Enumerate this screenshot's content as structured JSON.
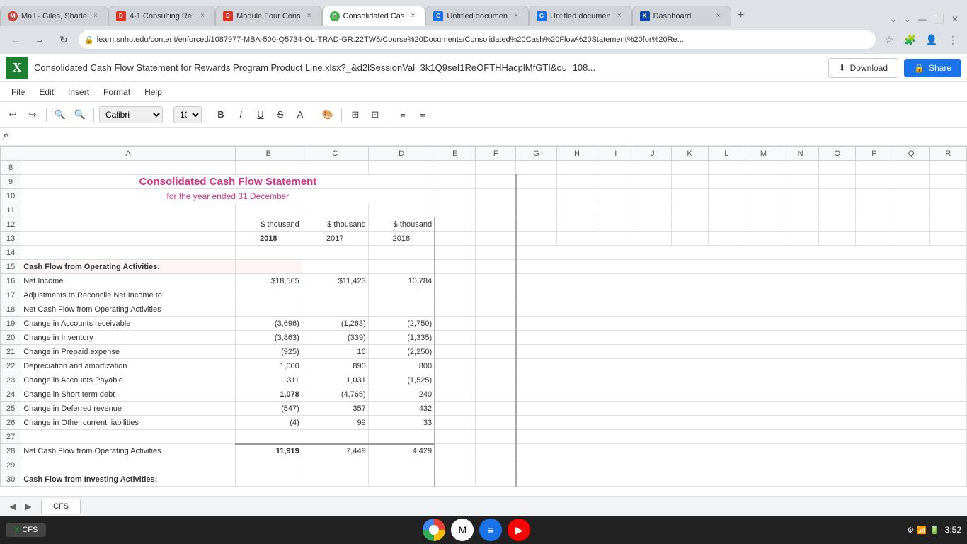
{
  "browser": {
    "tabs": [
      {
        "id": "tab1",
        "label": "Mail - Giles, Shade",
        "favicon": "M",
        "active": false,
        "favicon_color": "#1a73e8"
      },
      {
        "id": "tab2",
        "label": "4-1 Consulting Re:",
        "favicon": "D",
        "active": false,
        "favicon_color": "#d32f2f"
      },
      {
        "id": "tab3",
        "label": "Module Four Cons",
        "favicon": "D",
        "active": false,
        "favicon_color": "#d32f2f"
      },
      {
        "id": "tab4",
        "label": "Consolidated Cas",
        "favicon": "C",
        "active": true,
        "favicon_color": "#4caf50"
      },
      {
        "id": "tab5",
        "label": "Untitled documen",
        "favicon": "G",
        "active": false,
        "favicon_color": "#1a73e8"
      },
      {
        "id": "tab6",
        "label": "Untitled documen",
        "favicon": "G",
        "active": false,
        "favicon_color": "#1a73e8"
      },
      {
        "id": "tab7",
        "label": "Dashboard",
        "favicon": "K",
        "active": false,
        "favicon_color": "#0d47a1"
      }
    ],
    "address": "learn.snhu.edu/content/enforced/1087977-MBA-500-Q5734-OL-TRAD-GR.22TW5/Course%20Documents/Consolidated%20Cash%20Flow%20Statement%20for%20Re..."
  },
  "app": {
    "logo": "X",
    "title": "Consolidated Cash Flow Statement for Rewards Program Product Line.xlsx?_&d2lSessionVal=3k1Q9seI1ReOFTHHacplMfGTI&ou=108...",
    "download_label": "Download",
    "share_label": "Share"
  },
  "menu": {
    "items": [
      "File",
      "Edit",
      "Insert",
      "Format",
      "Help"
    ]
  },
  "toolbar": {
    "font": "Calibri",
    "size": "10"
  },
  "spreadsheet": {
    "columns": [
      "",
      "A",
      "B",
      "C",
      "D",
      "E",
      "F",
      "G",
      "H",
      "I",
      "J",
      "K",
      "L",
      "M",
      "N",
      "O",
      "P",
      "Q",
      "R"
    ],
    "title": "Consolidated Cash Flow Statement",
    "subtitle": "for the year ended 31 December",
    "rows": [
      {
        "num": 8,
        "cells": []
      },
      {
        "num": 9,
        "cells": [
          {
            "col": "merged_abc",
            "text": "Consolidated Cash Flow Statement",
            "class": "title-cell"
          }
        ]
      },
      {
        "num": 10,
        "cells": [
          {
            "col": "merged_abc",
            "text": "for the year ended 31 December",
            "class": "subtitle-cell"
          }
        ]
      },
      {
        "num": 11,
        "cells": []
      },
      {
        "num": 12,
        "cells": [
          {
            "col": "B",
            "text": "$ thousand",
            "class": "header-label"
          },
          {
            "col": "C",
            "text": "$ thousand",
            "class": "header-label"
          },
          {
            "col": "D",
            "text": "$ thousand",
            "class": "header-label"
          }
        ]
      },
      {
        "num": 13,
        "cells": [
          {
            "col": "B",
            "text": "2018",
            "class": "year-label"
          },
          {
            "col": "C",
            "text": "2017",
            "class": "year-label"
          },
          {
            "col": "D",
            "text": "2016",
            "class": "year-label"
          }
        ]
      },
      {
        "num": 14,
        "cells": []
      },
      {
        "num": 15,
        "cells": [
          {
            "col": "A",
            "text": "Cash Flow from Operating Activities:",
            "class": "section-label"
          }
        ]
      },
      {
        "num": 16,
        "cells": [
          {
            "col": "A",
            "text": "Net Income",
            "class": "item-label"
          },
          {
            "col": "B",
            "text": "$18,565",
            "class": "value-cell"
          },
          {
            "col": "C",
            "text": "$11,423",
            "class": "value-cell"
          },
          {
            "col": "D",
            "text": "10,784",
            "class": "value-cell"
          }
        ]
      },
      {
        "num": 17,
        "cells": [
          {
            "col": "A",
            "text": "Adjustments to Reconcile Net Income to",
            "class": "item-label"
          }
        ]
      },
      {
        "num": 18,
        "cells": [
          {
            "col": "A",
            "text": "Net Cash Flow from Operating Activities",
            "class": "item-label"
          }
        ]
      },
      {
        "num": 19,
        "cells": [
          {
            "col": "A",
            "text": "Change in Accounts receivable",
            "class": "item-label"
          },
          {
            "col": "B",
            "text": "(3,696)",
            "class": "value-cell"
          },
          {
            "col": "C",
            "text": "(1,263)",
            "class": "value-cell"
          },
          {
            "col": "D",
            "text": "(2,750)",
            "class": "value-cell"
          }
        ]
      },
      {
        "num": 20,
        "cells": [
          {
            "col": "A",
            "text": "Change in Inventory",
            "class": "item-label"
          },
          {
            "col": "B",
            "text": "(3,863)",
            "class": "value-cell"
          },
          {
            "col": "C",
            "text": "(339)",
            "class": "value-cell"
          },
          {
            "col": "D",
            "text": "(1,335)",
            "class": "value-cell"
          }
        ]
      },
      {
        "num": 21,
        "cells": [
          {
            "col": "A",
            "text": "Change in Prepaid expense",
            "class": "item-label"
          },
          {
            "col": "B",
            "text": "(925)",
            "class": "value-cell"
          },
          {
            "col": "C",
            "text": "16",
            "class": "value-cell"
          },
          {
            "col": "D",
            "text": "(2,250)",
            "class": "value-cell"
          }
        ]
      },
      {
        "num": 22,
        "cells": [
          {
            "col": "A",
            "text": "Depreciation and amortization",
            "class": "item-label"
          },
          {
            "col": "B",
            "text": "1,000",
            "class": "value-cell"
          },
          {
            "col": "C",
            "text": "890",
            "class": "value-cell"
          },
          {
            "col": "D",
            "text": "800",
            "class": "value-cell"
          }
        ]
      },
      {
        "num": 23,
        "cells": [
          {
            "col": "A",
            "text": "Change in Accounts Payable",
            "class": "item-label"
          },
          {
            "col": "B",
            "text": "311",
            "class": "value-cell"
          },
          {
            "col": "C",
            "text": "1,031",
            "class": "value-cell"
          },
          {
            "col": "D",
            "text": "(1,525)",
            "class": "value-cell"
          }
        ]
      },
      {
        "num": 24,
        "cells": [
          {
            "col": "A",
            "text": "Change in Short term debt",
            "class": "item-label"
          },
          {
            "col": "B",
            "text": "1,078",
            "class": "value-bold"
          },
          {
            "col": "C",
            "text": "(4,765)",
            "class": "value-cell"
          },
          {
            "col": "D",
            "text": "240",
            "class": "value-cell"
          }
        ]
      },
      {
        "num": 25,
        "cells": [
          {
            "col": "A",
            "text": "Change in Deferred revenue",
            "class": "item-label"
          },
          {
            "col": "B",
            "text": "(547)",
            "class": "value-cell"
          },
          {
            "col": "C",
            "text": "357",
            "class": "value-cell"
          },
          {
            "col": "D",
            "text": "432",
            "class": "value-cell"
          }
        ]
      },
      {
        "num": 26,
        "cells": [
          {
            "col": "A",
            "text": "Change in Other current liabilities",
            "class": "item-label"
          },
          {
            "col": "B",
            "text": "(4)",
            "class": "value-cell"
          },
          {
            "col": "C",
            "text": "99",
            "class": "value-cell"
          },
          {
            "col": "D",
            "text": "33",
            "class": "value-cell"
          }
        ]
      },
      {
        "num": 27,
        "cells": []
      },
      {
        "num": 28,
        "cells": [
          {
            "col": "A",
            "text": "Net Cash Flow from Operating Activities",
            "class": "item-label"
          },
          {
            "col": "B",
            "text": "11,919",
            "class": "value-bold"
          },
          {
            "col": "C",
            "text": "7,449",
            "class": "value-cell"
          },
          {
            "col": "D",
            "text": "4,429",
            "class": "value-cell"
          }
        ]
      },
      {
        "num": 29,
        "cells": []
      },
      {
        "num": 30,
        "cells": [
          {
            "col": "A",
            "text": "Cash Flow from Investing Activities:",
            "class": "section-label"
          }
        ]
      }
    ]
  },
  "sheet_tab": "CFS",
  "taskbar": {
    "time": "3:52",
    "chrome_icon": "⬤",
    "gmail_icon": "M",
    "docs_icon": "≡",
    "youtube_icon": "▶"
  }
}
